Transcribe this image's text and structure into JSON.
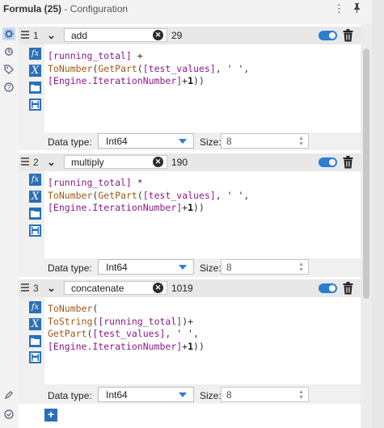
{
  "window": {
    "title_bold": "Formula (25)",
    "title_rest": " - Configuration"
  },
  "colors": {
    "accent": "#2c7cd3",
    "tool_button": "#2a6fb8",
    "string_field": "#8a1a8a",
    "function": "#9b5a14"
  },
  "formulas": [
    {
      "index": "1",
      "name": "add",
      "output": "29",
      "code_lines": [
        [
          {
            "t": "[running_total] ",
            "c": "field"
          },
          {
            "t": "+",
            "c": "op"
          }
        ],
        [
          {
            "t": "ToNumber",
            "c": "fn"
          },
          {
            "t": "(",
            "c": "op"
          },
          {
            "t": "GetPart",
            "c": "fn"
          },
          {
            "t": "(",
            "c": "op"
          },
          {
            "t": "[test_values]",
            "c": "field"
          },
          {
            "t": ", ",
            "c": "op"
          },
          {
            "t": "' '",
            "c": "str"
          },
          {
            "t": ",",
            "c": "op"
          }
        ],
        [
          {
            "t": "[Engine.IterationNumber]",
            "c": "field"
          },
          {
            "t": "+",
            "c": "op"
          },
          {
            "t": "1",
            "c": "num"
          },
          {
            "t": "))",
            "c": "op"
          }
        ]
      ],
      "data_type_label": "Data type:",
      "data_type": "Int64",
      "size_label": "Size:",
      "size": "8"
    },
    {
      "index": "2",
      "name": "multiply",
      "output": "190",
      "code_lines": [
        [
          {
            "t": "[running_total] ",
            "c": "field"
          },
          {
            "t": "*",
            "c": "op"
          }
        ],
        [
          {
            "t": "ToNumber",
            "c": "fn"
          },
          {
            "t": "(",
            "c": "op"
          },
          {
            "t": "GetPart",
            "c": "fn"
          },
          {
            "t": "(",
            "c": "op"
          },
          {
            "t": "[test_values]",
            "c": "field"
          },
          {
            "t": ", ",
            "c": "op"
          },
          {
            "t": "' '",
            "c": "str"
          },
          {
            "t": ",",
            "c": "op"
          }
        ],
        [
          {
            "t": "[Engine.IterationNumber]",
            "c": "field"
          },
          {
            "t": "+",
            "c": "op"
          },
          {
            "t": "1",
            "c": "num"
          },
          {
            "t": "))",
            "c": "op"
          }
        ]
      ],
      "data_type_label": "Data type:",
      "data_type": "Int64",
      "size_label": "Size:",
      "size": "8"
    },
    {
      "index": "3",
      "name": "concatenate",
      "output": "1019",
      "code_lines": [
        [
          {
            "t": "ToNumber",
            "c": "fn"
          },
          {
            "t": "(",
            "c": "op"
          }
        ],
        [
          {
            "t": "ToString",
            "c": "fn"
          },
          {
            "t": "(",
            "c": "op"
          },
          {
            "t": "[running_total]",
            "c": "field"
          },
          {
            "t": ")+",
            "c": "op"
          }
        ],
        [
          {
            "t": "GetPart",
            "c": "fn"
          },
          {
            "t": "(",
            "c": "op"
          },
          {
            "t": "[test_values]",
            "c": "field"
          },
          {
            "t": ", ",
            "c": "op"
          },
          {
            "t": "' '",
            "c": "str"
          },
          {
            "t": ",",
            "c": "op"
          }
        ],
        [
          {
            "t": "[Engine.IterationNumber]",
            "c": "field"
          },
          {
            "t": "+",
            "c": "op"
          },
          {
            "t": "1",
            "c": "num"
          },
          {
            "t": "))",
            "c": "op"
          }
        ]
      ],
      "data_type_label": "Data type:",
      "data_type": "Int64",
      "size_label": "Size:",
      "size": "8"
    }
  ],
  "icons": {
    "menu": "more-vert-icon",
    "pin": "pin-icon",
    "sidebar": [
      "gear-icon",
      "refresh-icon",
      "tag-icon",
      "help-icon"
    ],
    "bottom": [
      "pencil-icon",
      "check-circle-icon"
    ],
    "tools": [
      "fx-icon",
      "variable-icon",
      "folder-icon",
      "save-icon"
    ],
    "add": "plus-icon"
  }
}
